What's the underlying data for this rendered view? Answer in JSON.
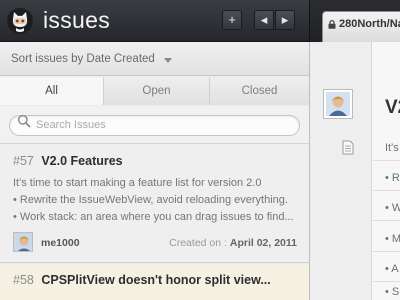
{
  "app": {
    "title": "issues"
  },
  "toolbar": {
    "add_label": "+",
    "prev_label": "◂",
    "next_label": "▸"
  },
  "repo": {
    "name": "280North/Na"
  },
  "sort": {
    "label": "Sort issues by Date Created"
  },
  "tabs": [
    {
      "label": "All",
      "active": true
    },
    {
      "label": "Open",
      "active": false
    },
    {
      "label": "Closed",
      "active": false
    }
  ],
  "search": {
    "placeholder": "Search Issues"
  },
  "issues": [
    {
      "number": "#57",
      "title": "V2.0 Features",
      "lines": [
        "It's time to start making a feature list for version 2.0",
        "• Rewrite the IssueWebView, avoid reloading everything.",
        "• Work stack: an area where you can drag issues to find..."
      ],
      "author": "me1000",
      "created_label": "Created on :",
      "created_date": "April 02, 2011"
    },
    {
      "number": "#58",
      "title": "CPSPlitView doesn't honor split view...",
      "lines": []
    }
  ],
  "detail": {
    "title": "V2",
    "lines": [
      "It's",
      "• R",
      "• W",
      "• M",
      "• A",
      "• S"
    ]
  },
  "colors": {
    "accent_bg": "#2a2c30",
    "selected_issue_bg": "#f4f1e3"
  }
}
